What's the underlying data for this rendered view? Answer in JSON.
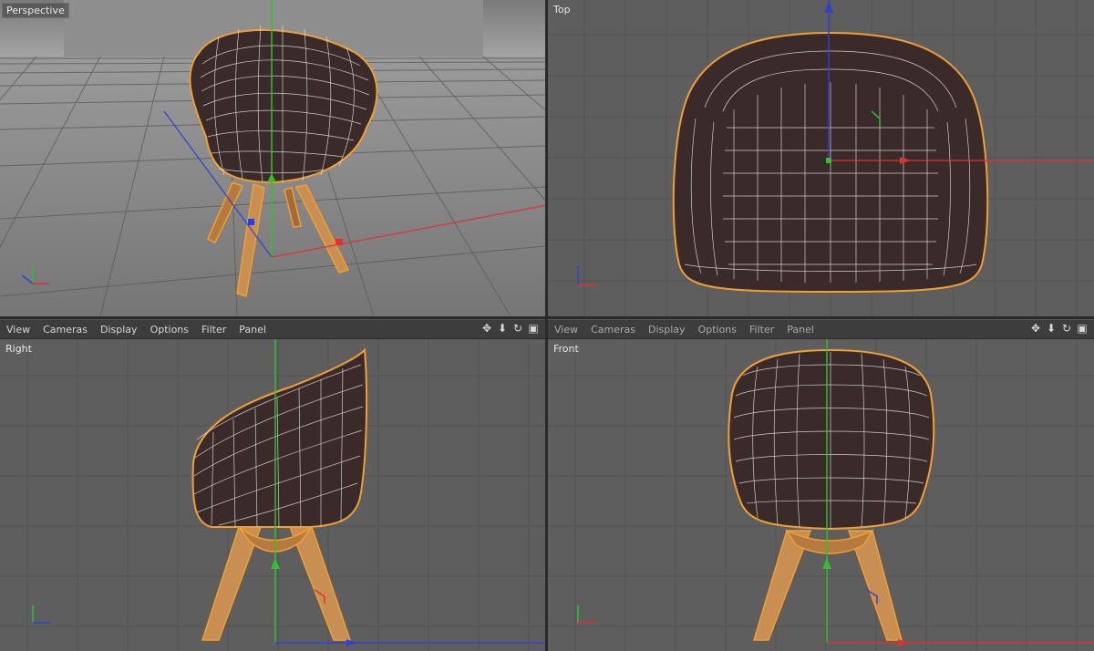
{
  "viewports": {
    "perspective": {
      "title": "Perspective"
    },
    "top": {
      "title": "Top"
    },
    "right": {
      "title": "Right"
    },
    "front": {
      "title": "Front"
    }
  },
  "menu": {
    "items": [
      "View",
      "Cameras",
      "Display",
      "Options",
      "Filter",
      "Panel"
    ]
  },
  "nav_icons": [
    "move-view-icon",
    "dolly-view-icon",
    "rotate-view-icon",
    "toggle-view-icon"
  ],
  "axes": {
    "x": "X",
    "y": "Y",
    "z": "Z"
  },
  "colors": {
    "viewport_bg": "#5e5e5e",
    "fabric": "#3a2a2a",
    "wood": "#c98e52",
    "highlight": "#f0a030",
    "axis_x": "#e03030",
    "axis_y": "#30c030",
    "axis_z": "#3040d0"
  }
}
